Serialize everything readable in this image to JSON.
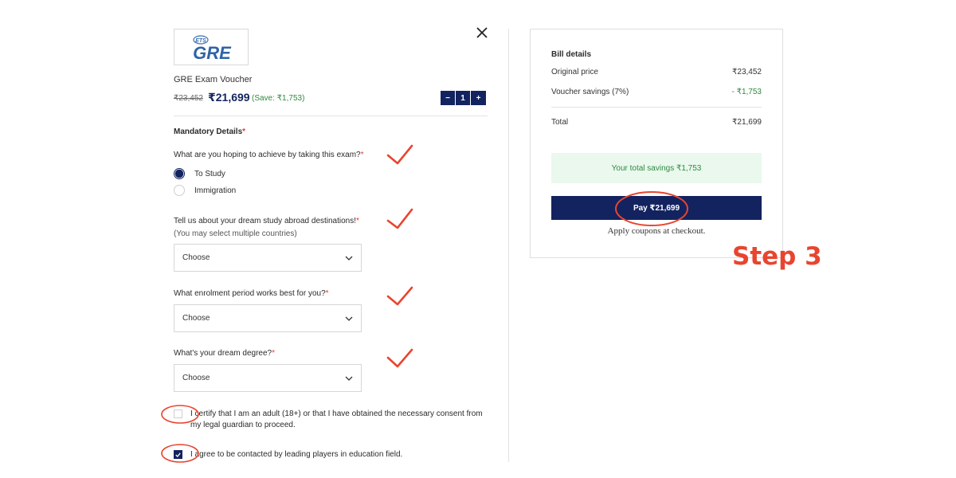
{
  "product": {
    "logo_brand": "ETS",
    "logo_text": "GRE",
    "title": "GRE Exam Voucher",
    "old_price": "₹23,452",
    "new_price": "₹21,699",
    "save_text": "(Save: ₹1,753)",
    "quantity": "1",
    "decrement_label": "−",
    "increment_label": "+"
  },
  "form": {
    "section_title": "Mandatory Details",
    "required_mark": "*",
    "q1": "What are you hoping to achieve by taking this exam?",
    "q1_options": [
      "To Study",
      "Immigration"
    ],
    "q2": "Tell us about your dream study abroad destinations!",
    "q2_sub": "(You may select multiple countries)",
    "q3": "What enrolment period works best for you?",
    "q4": "What's your dream degree?",
    "select_placeholder": "Choose",
    "consent1": "I certify that I am an adult (18+) or that I have obtained the necessary consent from my legal guardian to proceed.",
    "consent2": "I agree to be contacted by leading players in education field."
  },
  "bill": {
    "title": "Bill details",
    "original_label": "Original price",
    "original_value": "₹23,452",
    "savings_label": "Voucher savings (7%)",
    "savings_value": "- ₹1,753",
    "total_label": "Total",
    "total_value": "₹21,699",
    "savings_banner": "Your total savings ₹1,753",
    "pay_button": "Pay ₹21,699",
    "coupon_note": "Apply coupons at checkout."
  },
  "annotation": {
    "step_label": "Step 3",
    "color": "#e8452f"
  },
  "colors": {
    "primary": "#13235f",
    "success": "#2e8b3e",
    "success_bg": "#eaf8ee",
    "required": "#e23b3b"
  }
}
